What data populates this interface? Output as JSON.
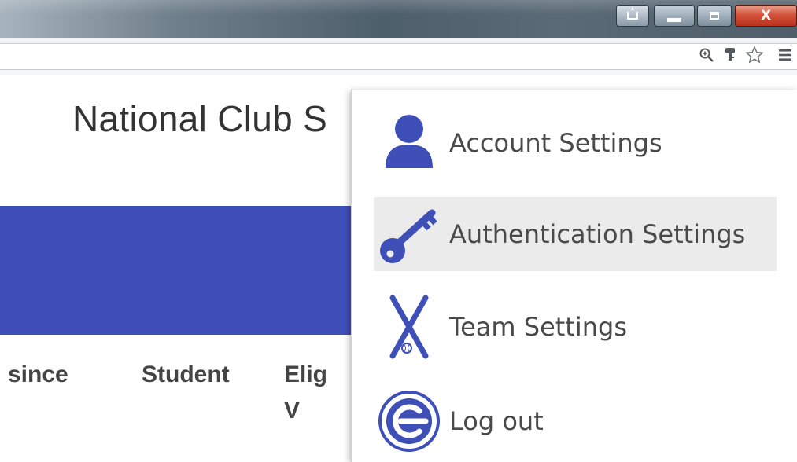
{
  "window_buttons": {
    "close_label": "X"
  },
  "page": {
    "title": "National Club S"
  },
  "table": {
    "headers": [
      "since",
      "Student",
      "Elig",
      "V"
    ]
  },
  "menu": {
    "items": [
      {
        "label": "Account Settings",
        "icon": "user-icon"
      },
      {
        "label": "Authentication Settings",
        "icon": "key-icon"
      },
      {
        "label": "Team Settings",
        "icon": "crossed-bats-icon"
      },
      {
        "label": "Log out",
        "icon": "logout-icon"
      }
    ],
    "icon_color": "#3f4fb8",
    "hover_background": "#ebebeb"
  },
  "colors": {
    "brand_blue": "#3f4fb8",
    "close_red": "#d4543c"
  }
}
